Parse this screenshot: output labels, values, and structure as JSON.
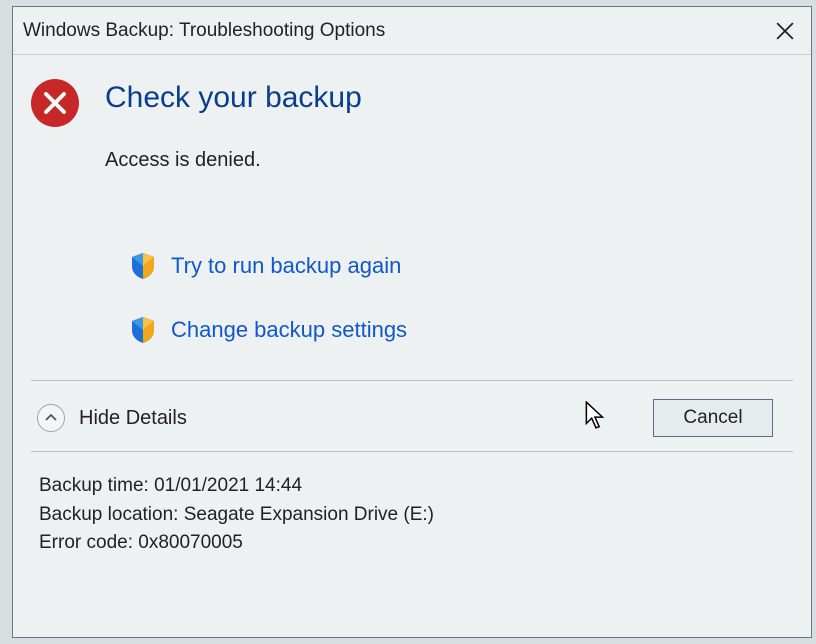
{
  "window": {
    "title": "Windows Backup: Troubleshooting Options"
  },
  "main": {
    "heading": "Check your backup",
    "message": "Access is denied."
  },
  "actions": {
    "retry": "Try to run backup again",
    "change": "Change backup settings"
  },
  "detailsToggle": "Hide Details",
  "buttons": {
    "cancel": "Cancel"
  },
  "details": {
    "backup_time_label": "Backup time",
    "backup_time_value": "01/01/2021 14:44",
    "backup_location_label": "Backup location",
    "backup_location_value": "Seagate Expansion Drive (E:)",
    "error_code_label": "Error code",
    "error_code_value": "0x80070005"
  }
}
